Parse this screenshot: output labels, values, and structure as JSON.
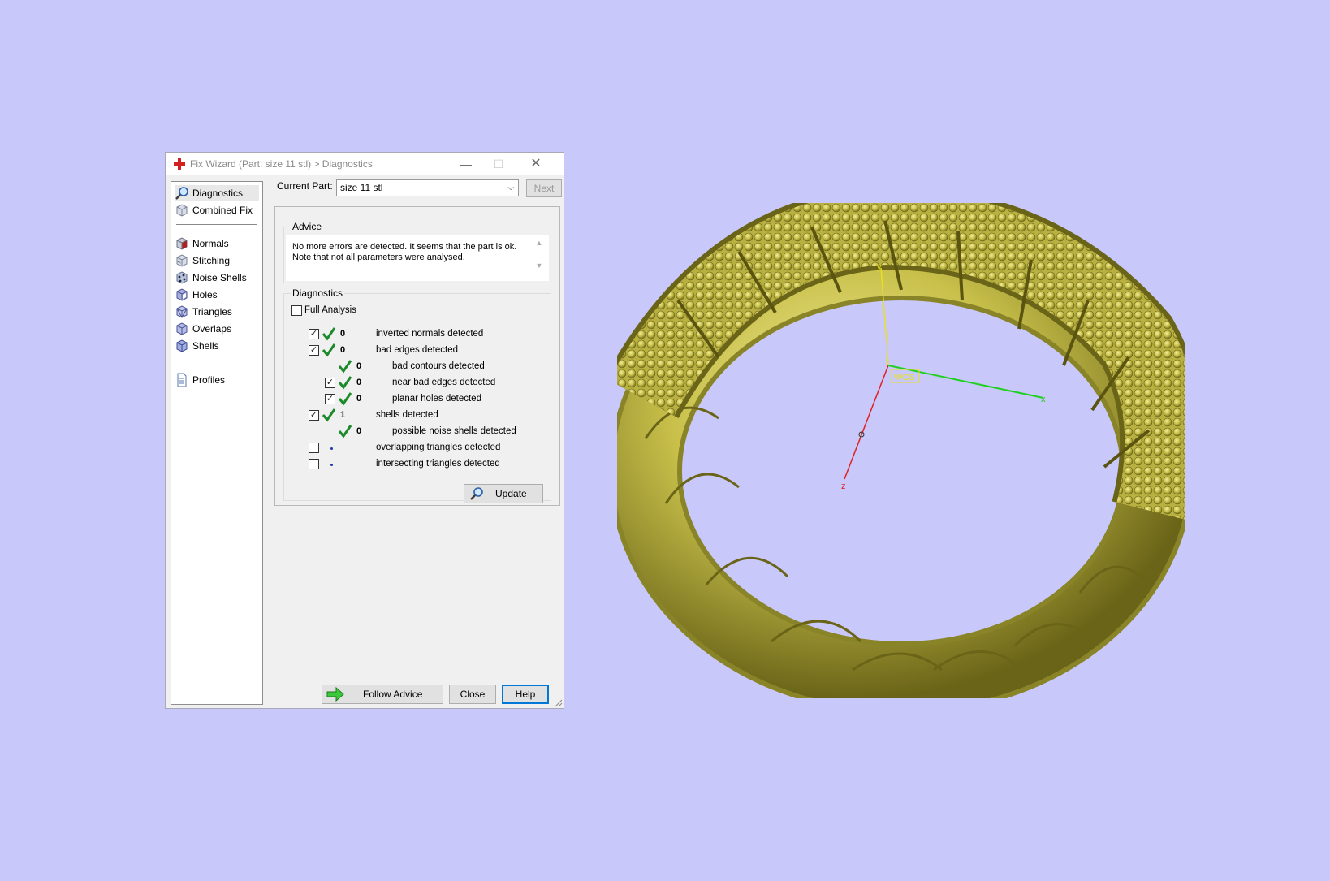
{
  "window": {
    "title": "Fix Wizard (Part: size 11 stl) > Diagnostics",
    "controls": {
      "minimize": "—",
      "maximize": "☐",
      "close": "✕"
    }
  },
  "sidebar": {
    "items": [
      {
        "label": "Diagnostics",
        "icon": "magnifier-icon",
        "selected": true
      },
      {
        "label": "Combined Fix",
        "icon": "cube-icon"
      },
      {
        "label": "Normals",
        "icon": "red-cube-icon"
      },
      {
        "label": "Stitching",
        "icon": "stitch-cube-icon"
      },
      {
        "label": "Noise Shells",
        "icon": "noise-cube-icon"
      },
      {
        "label": "Holes",
        "icon": "holes-cube-icon"
      },
      {
        "label": "Triangles",
        "icon": "triangles-cube-icon"
      },
      {
        "label": "Overlaps",
        "icon": "overlaps-cube-icon"
      },
      {
        "label": "Shells",
        "icon": "shells-cube-icon"
      },
      {
        "label": "Profiles",
        "icon": "document-icon"
      }
    ]
  },
  "current_part": {
    "label": "Current Part:",
    "value": "size 11 stl",
    "next_label": "Next"
  },
  "advice": {
    "title": "Advice",
    "line1": "No more errors are detected. It seems that the part is ok.",
    "line2": "Note that not all parameters were analysed."
  },
  "diagnostics": {
    "title": "Diagnostics",
    "full_analysis": "Full Analysis",
    "rows": [
      {
        "count": "0",
        "label": "inverted normals detected",
        "checked": true,
        "ok": true
      },
      {
        "count": "0",
        "label": "bad edges detected",
        "checked": true,
        "ok": true
      },
      {
        "count": "0",
        "label": "bad contours detected",
        "ok": true
      },
      {
        "count": "0",
        "label": "near bad edges detected",
        "checked": true,
        "ok": true
      },
      {
        "count": "0",
        "label": "planar holes detected",
        "checked": true,
        "ok": true
      },
      {
        "count": "1",
        "label": "shells detected",
        "checked": true,
        "ok": true
      },
      {
        "count": "0",
        "label": "possible noise shells detected",
        "ok": true
      },
      {
        "count": "",
        "label": "overlapping triangles detected",
        "checked": false,
        "ok": false
      },
      {
        "count": "",
        "label": "intersecting triangles detected",
        "checked": false,
        "ok": false
      }
    ],
    "update_label": "Update"
  },
  "footer": {
    "follow_advice": "Follow Advice",
    "close": "Close",
    "help": "Help"
  },
  "viewport": {
    "axis_label_z": "z",
    "axis_label_x": "x",
    "axis_label_y": "y",
    "wcs_label": "WCS",
    "model_color": "#c8c04a",
    "background": "#c8c8fa"
  }
}
